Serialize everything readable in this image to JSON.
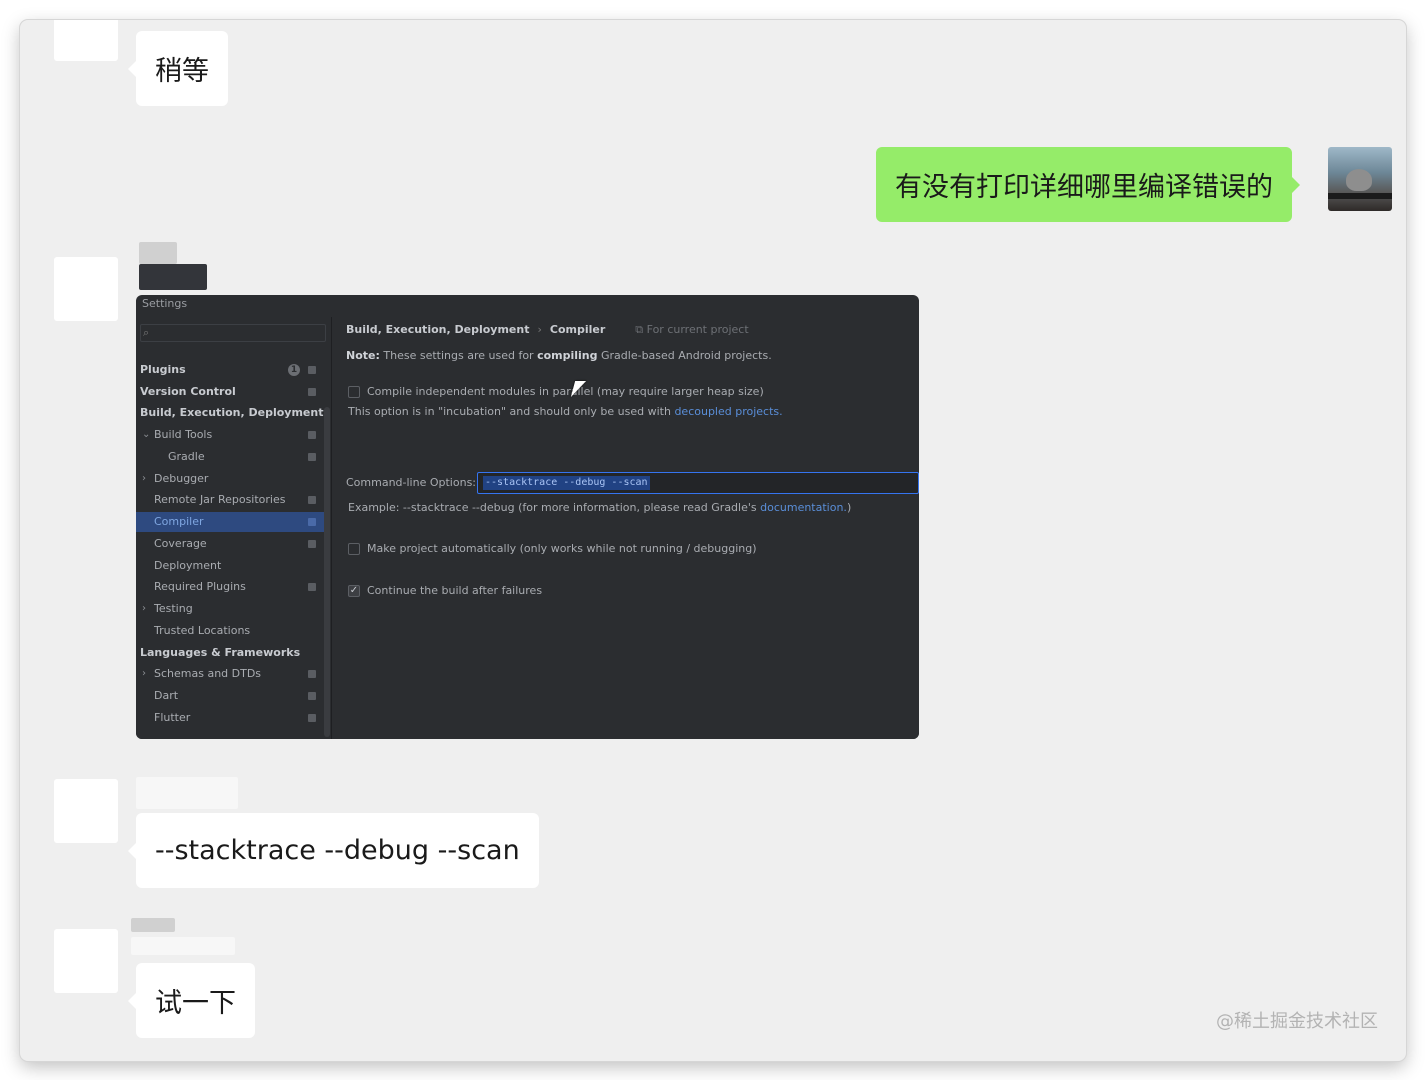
{
  "messages": [
    {
      "side": "left",
      "text": "稍等"
    },
    {
      "side": "right",
      "text": "有没有打印详细哪里编译错误的"
    },
    {
      "side": "left",
      "type": "image"
    },
    {
      "side": "left",
      "text": "--stacktrace --debug --scan"
    },
    {
      "side": "left",
      "text": "试一下"
    }
  ],
  "watermark": "@稀土掘金技术社区",
  "ide": {
    "window_title": "Settings",
    "search_placeholder": "⌕",
    "sidebar": {
      "plugins": "Plugins",
      "plugins_badge": "1",
      "version_control": "Version Control",
      "build_execution_deployment": "Build, Execution, Deployment",
      "build_tools": "Build Tools",
      "gradle": "Gradle",
      "debugger": "Debugger",
      "remote_jar": "Remote Jar Repositories",
      "compiler": "Compiler",
      "coverage": "Coverage",
      "deployment": "Deployment",
      "required_plugins": "Required Plugins",
      "testing": "Testing",
      "trusted_locations": "Trusted Locations",
      "languages_frameworks": "Languages & Frameworks",
      "schemas": "Schemas and DTDs",
      "dart": "Dart",
      "flutter": "Flutter"
    },
    "main": {
      "crumb_parent": "Build, Execution, Deployment",
      "crumb_sep": "›",
      "crumb_current": "Compiler",
      "scope": "⧉ For current project",
      "note_label": "Note:",
      "note_pre": "These settings are used for",
      "note_bold": "compiling",
      "note_post": "Gradle-based Android projects.",
      "compile_independent": "Compile independent modules in parallel (may require larger heap size)",
      "incubation_pre": "This option is in \"incubation\" and should only be used with",
      "incubation_link": "decoupled projects.",
      "cmdline_label": "Command-line Options:",
      "cmdline_value": "--stacktrace --debug --scan",
      "example_pre": "Example: --stacktrace --debug (for more information, please read Gradle's",
      "example_link": "documentation.",
      "example_post": ")",
      "make_auto": "Make project automatically (only works while not running / debugging)",
      "continue_build": "Continue the build after failures",
      "continue_checked": "✓"
    }
  }
}
